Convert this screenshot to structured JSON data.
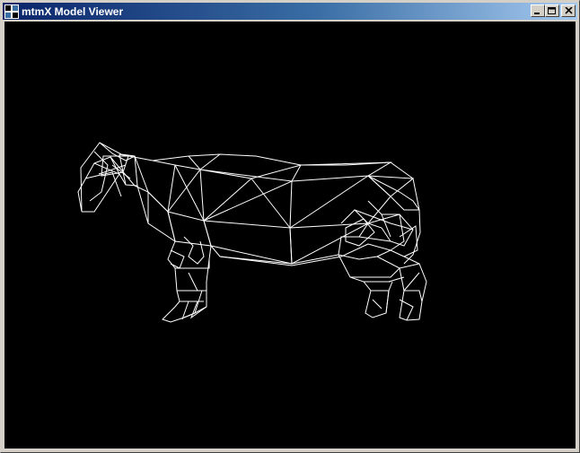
{
  "window": {
    "title": "mtmX Model Viewer",
    "icon": "app-logo-icon",
    "controls": [
      "minimize-icon",
      "maximize-icon",
      "close-icon"
    ],
    "accent_color": "#0a246a"
  },
  "viewport": {
    "background": "#000000",
    "render_mode": "wireframe",
    "model": "cow",
    "line_color": "#ffffff"
  }
}
